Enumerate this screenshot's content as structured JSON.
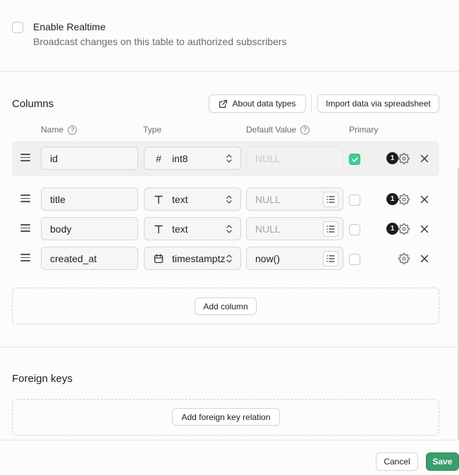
{
  "realtime": {
    "title": "Enable Realtime",
    "description": "Broadcast changes on this table to authorized subscribers",
    "checked": false
  },
  "columns_section": {
    "title": "Columns",
    "about_button": "About data types",
    "import_button": "Import data via spreadsheet",
    "headers": {
      "name": "Name",
      "type": "Type",
      "default": "Default Value",
      "primary": "Primary"
    },
    "help_glyph": "?",
    "rows": [
      {
        "name": "id",
        "type": "int8",
        "type_icon": "hash-icon",
        "default": "NULL",
        "default_is_null": true,
        "primary": true,
        "badge": "1",
        "has_list_button": false
      },
      {
        "name": "title",
        "type": "text",
        "type_icon": "text-type-icon",
        "default": "NULL",
        "default_is_null": true,
        "primary": false,
        "badge": "1",
        "has_list_button": true
      },
      {
        "name": "body",
        "type": "text",
        "type_icon": "text-type-icon",
        "default": "NULL",
        "default_is_null": true,
        "primary": false,
        "badge": "1",
        "has_list_button": true
      },
      {
        "name": "created_at",
        "type": "timestamptz",
        "type_icon": "calendar-icon",
        "default": "now()",
        "default_is_null": false,
        "primary": false,
        "badge": "",
        "has_list_button": true
      }
    ],
    "add_column_button": "Add column"
  },
  "foreign_keys_section": {
    "title": "Foreign keys",
    "add_button": "Add foreign key relation"
  },
  "footer": {
    "cancel": "Cancel",
    "save": "Save"
  },
  "colors": {
    "accent": "#3ecf8e",
    "save": "#3a9e6e"
  }
}
